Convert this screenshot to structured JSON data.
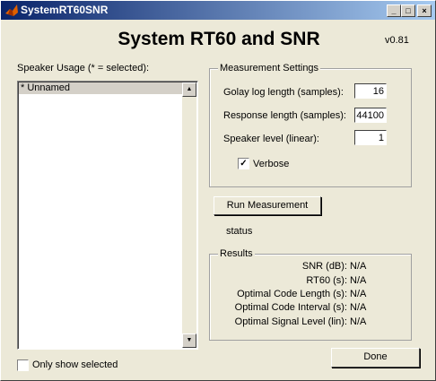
{
  "window": {
    "title": "SystemRT60SNR",
    "min_glyph": "_",
    "max_glyph": "□",
    "close_glyph": "×"
  },
  "header": {
    "title": "System RT60 and SNR",
    "version": "v0.81"
  },
  "speaker_panel": {
    "label": "Speaker Usage (* = selected):",
    "items": [
      "* Unnamed"
    ],
    "only_show_selected_label": "Only show selected",
    "only_show_selected_checked": false
  },
  "measurement_settings": {
    "title": "Measurement Settings",
    "golay_label": "Golay log length (samples):",
    "golay_value": "16",
    "response_label": "Response length (samples):",
    "response_value": "44100",
    "speaker_level_label": "Speaker level (linear):",
    "speaker_level_value": "1",
    "verbose_label": "Verbose",
    "verbose_checked": true,
    "check_glyph": "✓"
  },
  "run_button_label": "Run Measurement",
  "status_text": "status",
  "results": {
    "title": "Results",
    "rows": [
      {
        "label": "SNR (dB):",
        "value": "N/A"
      },
      {
        "label": "RT60 (s):",
        "value": "N/A"
      },
      {
        "label": "Optimal Code Length (s):",
        "value": "N/A"
      },
      {
        "label": "Optimal Code Interval (s):",
        "value": "N/A"
      },
      {
        "label": "Optimal Signal Level (lin):",
        "value": "N/A"
      }
    ]
  },
  "done_button_label": "Done",
  "scroll": {
    "up_glyph": "▲",
    "down_glyph": "▼"
  }
}
